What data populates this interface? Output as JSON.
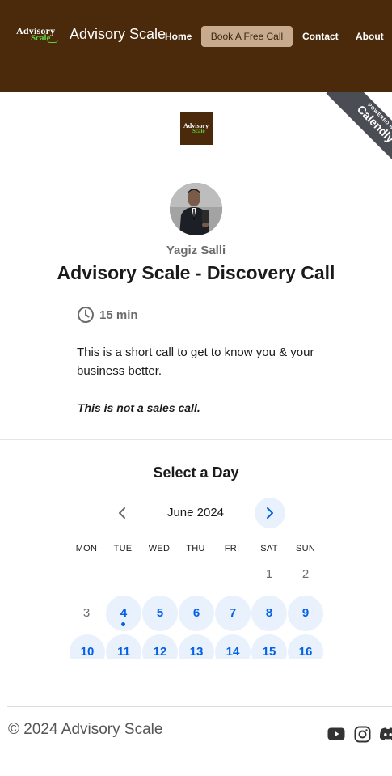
{
  "header": {
    "logo_line1": "Advisory",
    "logo_line2": "Scale",
    "site_title": "Advisory Scale",
    "nav": {
      "home": "Home",
      "book": "Book A Free Call",
      "contact": "Contact",
      "about": "About"
    }
  },
  "calendly": {
    "ribbon_small": "POWERED BY",
    "ribbon_brand": "Calendly",
    "org_logo_line1": "Advisory",
    "org_logo_line2": "Scale",
    "host_name": "Yagiz Salli",
    "event_title": "Advisory Scale - Discovery Call",
    "duration": "15 min",
    "description": "This is a short call to get to know you & your business better.",
    "description_emphasis": "This is not a sales call.",
    "select_day_heading": "Select a Day",
    "month": "June 2024",
    "weekdays": [
      "MON",
      "TUE",
      "WED",
      "THU",
      "FRI",
      "SAT",
      "SUN"
    ],
    "days": {
      "d1": "1",
      "d2": "2",
      "d3": "3",
      "d4": "4",
      "d5": "5",
      "d6": "6",
      "d7": "7",
      "d8": "8",
      "d9": "9",
      "d10": "10",
      "d11": "11",
      "d12": "12",
      "d13": "13",
      "d14": "14",
      "d15": "15",
      "d16": "16"
    }
  },
  "footer": {
    "copyright": "© 2024 Advisory Scale",
    "social_icons": [
      "youtube-icon",
      "instagram-icon",
      "discord-icon"
    ]
  },
  "colors": {
    "header_bg": "#4a2a0a",
    "cta_bg": "#c8ab8f",
    "brand_green": "#5fcf3a",
    "calendar_blue": "#0060e6",
    "calendar_available_bg": "#e9f1fd"
  }
}
